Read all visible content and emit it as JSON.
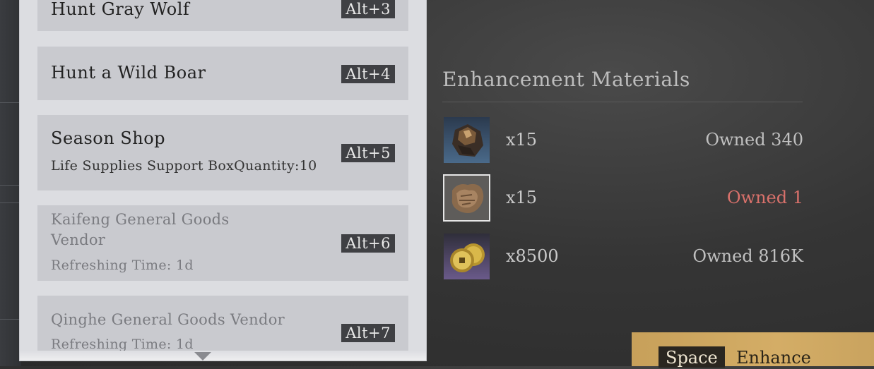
{
  "source_list": {
    "items": [
      {
        "title": "Hunt Gray Wolf",
        "subtitle": "",
        "hotkey": "Alt+3",
        "dimmed": false
      },
      {
        "title": "Hunt a Wild Boar",
        "subtitle": "",
        "hotkey": "Alt+4",
        "dimmed": false
      },
      {
        "title": "Season Shop",
        "subtitle": "Life Supplies Support BoxQuantity:10",
        "hotkey": "Alt+5",
        "dimmed": false
      },
      {
        "title_line1": "Kaifeng General Goods",
        "title_line2": "Vendor",
        "subtitle": "Refreshing Time: 1d",
        "hotkey": "Alt+6",
        "dimmed": true
      },
      {
        "title": "Qinghe General Goods Vendor",
        "subtitle": "Refreshing Time: 1d",
        "hotkey": "Alt+7",
        "dimmed": true
      }
    ]
  },
  "materials": {
    "title": "Enhancement Materials",
    "items": [
      {
        "icon": "ore-icon",
        "quantity": "x15",
        "owned": "Owned 340",
        "insufficient": false
      },
      {
        "icon": "leather-icon",
        "quantity": "x15",
        "owned": "Owned 1",
        "insufficient": true
      },
      {
        "icon": "coins-icon",
        "quantity": "x8500",
        "owned": "Owned 816K",
        "insufficient": false
      }
    ]
  },
  "enhance": {
    "key": "Space",
    "label": "Enhance"
  },
  "colors": {
    "insufficient": "#d9716b",
    "button": "#d4ad66"
  }
}
